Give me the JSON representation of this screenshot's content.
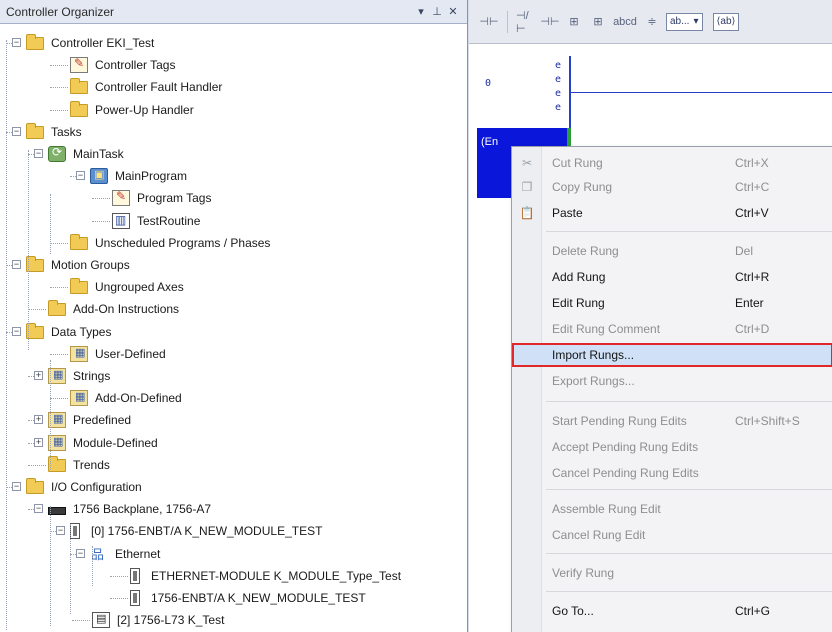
{
  "organizer": {
    "title": "Controller Organizer",
    "header_glyphs": [
      "▾",
      "⊥",
      "✕"
    ],
    "tree": [
      {
        "label": "Controller EKI_Test",
        "icon": "folder-icon"
      },
      {
        "label": "Controller Tags",
        "icon": "tags-icon"
      },
      {
        "label": "Controller Fault Handler",
        "icon": "folder-icon"
      },
      {
        "label": "Power-Up Handler",
        "icon": "folder-icon"
      },
      {
        "label": "Tasks",
        "icon": "folder-icon"
      },
      {
        "label": "MainTask",
        "icon": "task-icon"
      },
      {
        "label": "MainProgram",
        "icon": "program-icon"
      },
      {
        "label": "Program Tags",
        "icon": "tags-icon"
      },
      {
        "label": "TestRoutine",
        "icon": "routine-icon"
      },
      {
        "label": "Unscheduled Programs / Phases",
        "icon": "folder-icon"
      },
      {
        "label": "Motion Groups",
        "icon": "folder-icon"
      },
      {
        "label": "Ungrouped Axes",
        "icon": "folder-icon"
      },
      {
        "label": "Add-On Instructions",
        "icon": "folder-icon"
      },
      {
        "label": "Data Types",
        "icon": "folder-icon"
      },
      {
        "label": "User-Defined",
        "icon": "data-type-icon"
      },
      {
        "label": "Strings",
        "icon": "data-type-icon"
      },
      {
        "label": "Add-On-Defined",
        "icon": "data-type-icon"
      },
      {
        "label": "Predefined",
        "icon": "data-type-icon"
      },
      {
        "label": "Module-Defined",
        "icon": "data-type-icon"
      },
      {
        "label": "Trends",
        "icon": "folder-icon"
      },
      {
        "label": "I/O Configuration",
        "icon": "folder-icon"
      },
      {
        "label": "1756 Backplane, 1756-A7",
        "icon": "chassis-icon"
      },
      {
        "label": "[0] 1756-ENBT/A  K_NEW_MODULE_TEST",
        "icon": "module-icon"
      },
      {
        "label": "Ethernet",
        "icon": "network-icon"
      },
      {
        "label": "ETHERNET-MODULE  K_MODULE_Type_Test",
        "icon": "module-icon"
      },
      {
        "label": "1756-ENBT/A  K_NEW_MODULE_TEST",
        "icon": "module-icon"
      },
      {
        "label": "[2] 1756-L73  K_Test",
        "icon": "controller-icon"
      }
    ]
  },
  "toolbar": {
    "buttons": [
      "⊣⊢",
      "⊣/⊢",
      "⊣⊢",
      "⊞",
      "⊞",
      "abcd",
      "≑"
    ],
    "dropdown_value": "ab...",
    "dropdown_arrow": "▾",
    "tag_button": "⟨ab⟩"
  },
  "ladder": {
    "rung_number": "0",
    "rung_marks": [
      "e",
      "e",
      "e",
      "e"
    ],
    "end_label": "(En"
  },
  "context_menu": {
    "items": [
      {
        "label": "Cut Rung",
        "shortcut": "Ctrl+X",
        "icon": "cut-icon",
        "enabled": false
      },
      {
        "label": "Copy Rung",
        "shortcut": "Ctrl+C",
        "icon": "copy-icon",
        "enabled": false
      },
      {
        "label": "Paste",
        "shortcut": "Ctrl+V",
        "icon": "paste-icon",
        "enabled": true
      },
      {
        "label": "Delete Rung",
        "shortcut": "Del",
        "icon": "",
        "enabled": false
      },
      {
        "label": "Add Rung",
        "shortcut": "Ctrl+R",
        "icon": "",
        "enabled": true
      },
      {
        "label": "Edit Rung",
        "shortcut": "Enter",
        "icon": "",
        "enabled": true
      },
      {
        "label": "Edit Rung Comment",
        "shortcut": "Ctrl+D",
        "icon": "",
        "enabled": false
      },
      {
        "label": "Import Rungs...",
        "shortcut": "",
        "icon": "",
        "enabled": true,
        "highlighted": true
      },
      {
        "label": "Export Rungs...",
        "shortcut": "",
        "icon": "",
        "enabled": false
      },
      {
        "label": "Start Pending Rung Edits",
        "shortcut": "Ctrl+Shift+S",
        "icon": "",
        "enabled": false
      },
      {
        "label": "Accept Pending Rung Edits",
        "shortcut": "",
        "icon": "",
        "enabled": false
      },
      {
        "label": "Cancel Pending Rung Edits",
        "shortcut": "",
        "icon": "",
        "enabled": false
      },
      {
        "label": "Assemble Rung Edit",
        "shortcut": "",
        "icon": "",
        "enabled": false
      },
      {
        "label": "Cancel Rung Edit",
        "shortcut": "",
        "icon": "",
        "enabled": false
      },
      {
        "label": "Verify Rung",
        "shortcut": "",
        "icon": "",
        "enabled": false
      },
      {
        "label": "Go To...",
        "shortcut": "Ctrl+G",
        "icon": "",
        "enabled": true
      }
    ]
  },
  "colors": {
    "end_rung_fill": "#0a16d9",
    "rail": "#2740c8",
    "highlight_border": "#e02828",
    "highlight_fill": "#cfe0f7"
  }
}
